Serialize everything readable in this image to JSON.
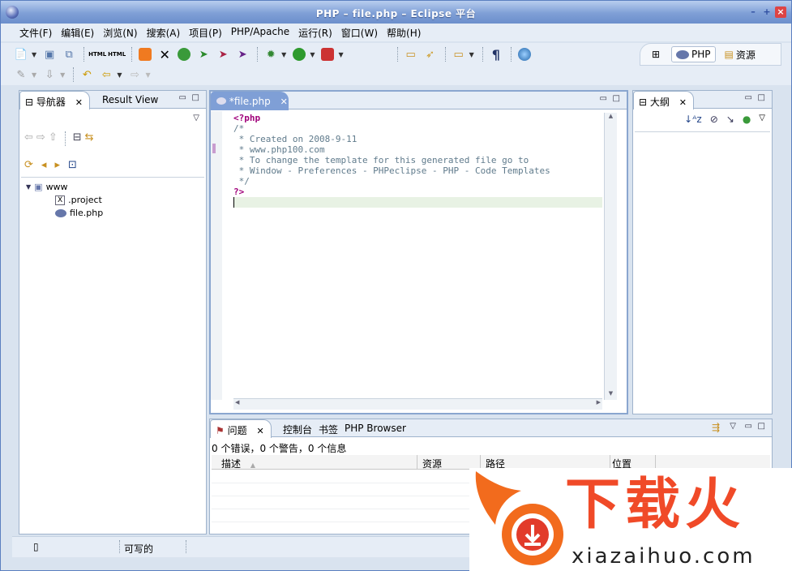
{
  "window": {
    "title": "PHP – file.php – Eclipse 平台"
  },
  "menu": [
    "文件(F)",
    "编辑(E)",
    "浏览(N)",
    "搜索(A)",
    "项目(P)",
    "PHP/Apache",
    "运行(R)",
    "窗口(W)",
    "帮助(H)"
  ],
  "perspectives": [
    {
      "label": "PHP",
      "icon": "php-perspective-icon"
    },
    {
      "label": "资源",
      "icon": "resource-perspective-icon"
    }
  ],
  "navigator": {
    "tabs": [
      {
        "label": "导航器"
      },
      {
        "label": "Result View"
      }
    ],
    "tree": {
      "root": "www",
      "children": [
        ".project",
        "file.php"
      ]
    }
  },
  "editor": {
    "tab_label": "*file.php",
    "lines": [
      "<?php",
      "/*",
      " * Created on 2008-9-11",
      " * www.php100.com",
      " * To change the template for this generated file go to",
      " * Window - Preferences - PHPeclipse - PHP - Code Templates",
      " */",
      "?>",
      ""
    ]
  },
  "outline": {
    "tab_label": "大纲"
  },
  "bottom": {
    "tabs": [
      {
        "label": "问题"
      },
      {
        "label": "控制台"
      },
      {
        "label": "书签"
      },
      {
        "label": "PHP Browser"
      }
    ],
    "summary": "0 个错误，0 个警告，0 个信息",
    "columns": [
      "描述",
      "资源",
      "路径",
      "位置"
    ]
  },
  "status": {
    "mode": "可写的"
  },
  "watermark": {
    "brand": "下载火",
    "site": "xiazaihuo.com"
  }
}
